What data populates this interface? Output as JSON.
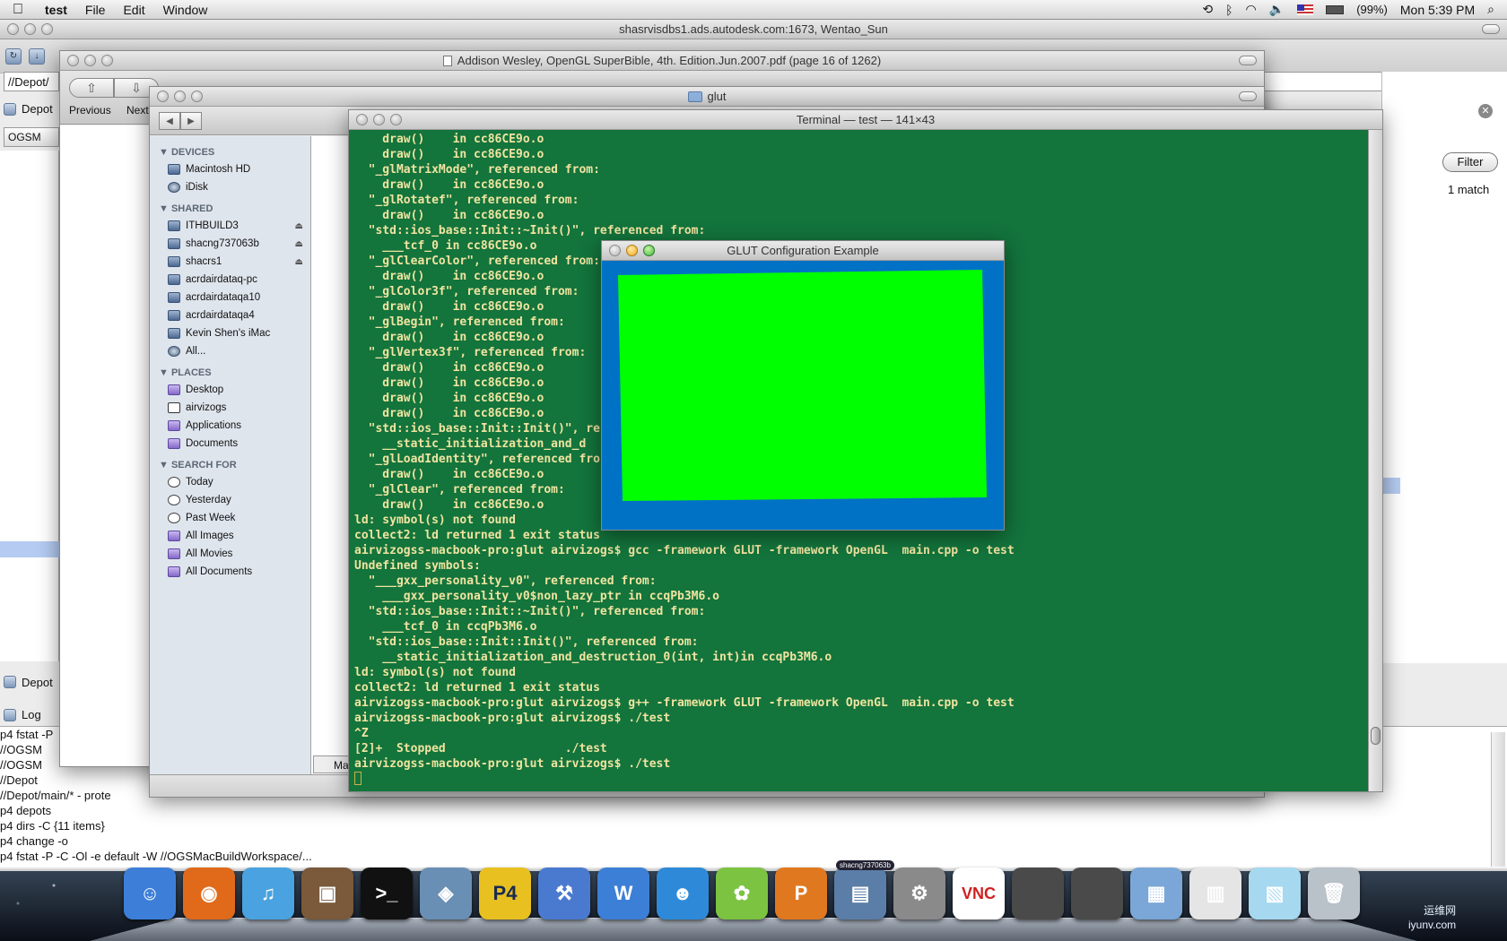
{
  "menubar": {
    "app": "test",
    "items": [
      "File",
      "Edit",
      "Window"
    ],
    "battery": "(99%)",
    "clock": "Mon 5:39 PM"
  },
  "p4v": {
    "title": "shasrvisdbs1.ads.autodesk.com:1673, Wentao_Sun",
    "path": "//Depot/",
    "depot_tab": "Depot",
    "workspace_btn": "OGSM",
    "depot_tab2": "Depot",
    "log_tab": "Log",
    "filter": "Filter",
    "match": "1 match",
    "log_lines": [
      "p4 fstat -P",
      "  //OGSM",
      "  //OGSM",
      "  //Depot",
      "  //Depot/main/* - prote",
      "p4 depots",
      "p4 dirs -C {11 items}",
      "p4 change -o",
      "p4 fstat -P -C -Ol -e default -W //OGSMacBuildWorkspace/..."
    ]
  },
  "preview": {
    "title": "Addison Wesley, OpenGL SuperBible, 4th. Edition.Jun.2007.pdf (page 16 of 1262)",
    "previous": "Previous",
    "next": "Next"
  },
  "finder": {
    "title": "glut",
    "tab": "Ma",
    "sections": [
      {
        "head": "DEVICES",
        "items": [
          {
            "label": "Macintosh HD",
            "icon": "hd-icon"
          },
          {
            "label": "iDisk",
            "icon": "idisk-icon"
          }
        ]
      },
      {
        "head": "SHARED",
        "items": [
          {
            "label": "ITHBUILD3",
            "icon": "computer-icon",
            "eject": true
          },
          {
            "label": "shacng737063b",
            "icon": "computer-icon",
            "eject": true
          },
          {
            "label": "shacrs1",
            "icon": "computer-icon",
            "eject": true
          },
          {
            "label": "acrdairdataq-pc",
            "icon": "computer-icon"
          },
          {
            "label": "acrdairdataqa10",
            "icon": "computer-icon"
          },
          {
            "label": "acrdairdataqa4",
            "icon": "computer-icon"
          },
          {
            "label": "Kevin Shen's iMac",
            "icon": "imac-icon"
          },
          {
            "label": "All...",
            "icon": "network-icon"
          }
        ]
      },
      {
        "head": "PLACES",
        "items": [
          {
            "label": "Desktop",
            "icon": "desktop-icon"
          },
          {
            "label": "airvizogs",
            "icon": "home-icon"
          },
          {
            "label": "Applications",
            "icon": "applications-icon"
          },
          {
            "label": "Documents",
            "icon": "documents-icon"
          }
        ]
      },
      {
        "head": "SEARCH FOR",
        "items": [
          {
            "label": "Today",
            "icon": "clock-icon"
          },
          {
            "label": "Yesterday",
            "icon": "clock-icon"
          },
          {
            "label": "Past Week",
            "icon": "clock-icon"
          },
          {
            "label": "All Images",
            "icon": "smart-folder-icon"
          },
          {
            "label": "All Movies",
            "icon": "smart-folder-icon"
          },
          {
            "label": "All Documents",
            "icon": "smart-folder-icon"
          }
        ]
      }
    ]
  },
  "terminal": {
    "title": "Terminal — test — 141×43",
    "lines": [
      "    draw()    in cc86CE9o.o",
      "    draw()    in cc86CE9o.o",
      "  \"_glMatrixMode\", referenced from:",
      "    draw()    in cc86CE9o.o",
      "  \"_glRotatef\", referenced from:",
      "    draw()    in cc86CE9o.o",
      "  \"std::ios_base::Init::~Init()\", referenced from:",
      "    ___tcf_0 in cc86CE9o.o",
      "  \"_glClearColor\", referenced from:",
      "    draw()    in cc86CE9o.o",
      "  \"_glColor3f\", referenced from:",
      "    draw()    in cc86CE9o.o",
      "  \"_glBegin\", referenced from:",
      "    draw()    in cc86CE9o.o",
      "  \"_glVertex3f\", referenced from:",
      "    draw()    in cc86CE9o.o",
      "    draw()    in cc86CE9o.o",
      "    draw()    in cc86CE9o.o",
      "    draw()    in cc86CE9o.o",
      "  \"std::ios_base::Init::Init()\", re",
      "    __static_initialization_and_d",
      "  \"_glLoadIdentity\", referenced fro",
      "    draw()    in cc86CE9o.o",
      "  \"_glClear\", referenced from:",
      "    draw()    in cc86CE9o.o",
      "ld: symbol(s) not found",
      "collect2: ld returned 1 exit status",
      "airvizogss-macbook-pro:glut airvizogs$ gcc -framework GLUT -framework OpenGL  main.cpp -o test",
      "Undefined symbols:",
      "  \"___gxx_personality_v0\", referenced from:",
      "    ___gxx_personality_v0$non_lazy_ptr in ccqPb3M6.o",
      "  \"std::ios_base::Init::~Init()\", referenced from:",
      "    ___tcf_0 in ccqPb3M6.o",
      "  \"std::ios_base::Init::Init()\", referenced from:",
      "    __static_initialization_and_destruction_0(int, int)in ccqPb3M6.o",
      "ld: symbol(s) not found",
      "collect2: ld returned 1 exit status",
      "airvizogss-macbook-pro:glut airvizogs$ g++ -framework GLUT -framework OpenGL  main.cpp -o test",
      "airvizogss-macbook-pro:glut airvizogs$ ./test",
      "^Z",
      "[2]+  Stopped                 ./test",
      "airvizogss-macbook-pro:glut airvizogs$ ./test"
    ],
    "bg_color": "#13743c",
    "text_color": "#f0e4a0"
  },
  "glut": {
    "title": "GLUT Configuration Example",
    "clear_color": "#0072c6",
    "quad_color": "#00ff00"
  },
  "dock": {
    "items": [
      {
        "name": "finder-dock-icon",
        "color": "#3d7fd8",
        "glyph": "☺"
      },
      {
        "name": "firefox-dock-icon",
        "color": "#e06a1a",
        "glyph": "◉"
      },
      {
        "name": "itunes-dock-icon",
        "color": "#4aa3e0",
        "glyph": "♫"
      },
      {
        "name": "iphoto-dock-icon",
        "color": "#7a5a3a",
        "glyph": "▣"
      },
      {
        "name": "terminal-dock-icon",
        "color": "#111111",
        "glyph": ">_"
      },
      {
        "name": "preview-dock-icon",
        "color": "#6a8fb4",
        "glyph": "◈"
      },
      {
        "name": "p4-dock-icon",
        "color": "#e8c020",
        "glyph": "P4"
      },
      {
        "name": "xcode-dock-icon",
        "color": "#4a7ad0",
        "glyph": "⚒"
      },
      {
        "name": "word-dock-icon",
        "color": "#3c7fd6",
        "glyph": "W"
      },
      {
        "name": "messenger-dock-icon",
        "color": "#2e8ad8",
        "glyph": "☻"
      },
      {
        "name": "lync-dock-icon",
        "color": "#7cc342",
        "glyph": "✿"
      },
      {
        "name": "powerpoint-dock-icon",
        "color": "#e07820",
        "glyph": "P"
      },
      {
        "name": "remote-desktop-dock-icon",
        "color": "#5b7ea8",
        "glyph": "▤",
        "badge": "shacng737063b"
      },
      {
        "name": "utility-dock-icon",
        "color": "#8a8a8a",
        "glyph": "⚙"
      },
      {
        "name": "vnc-dock-icon",
        "color": "#ffffff",
        "glyph": "VNC"
      },
      {
        "name": "window-thumbnail-1-dock-icon",
        "color": "#4a4a4a",
        "glyph": ""
      },
      {
        "name": "window-thumbnail-2-dock-icon",
        "color": "#4a4a4a",
        "glyph": ""
      },
      {
        "name": "documents-stack-dock-icon",
        "color": "#7aa7d8",
        "glyph": "▦"
      },
      {
        "name": "pdf-stack-dock-icon",
        "color": "#e5e5e5",
        "glyph": "▥"
      },
      {
        "name": "screenshot-stack-dock-icon",
        "color": "#a6d8f0",
        "glyph": "▧"
      },
      {
        "name": "trash-dock-icon",
        "color": "#b9c1c9",
        "glyph": "🗑"
      }
    ],
    "watermark_cn": "运维网",
    "watermark_url": "iyunv.com"
  }
}
